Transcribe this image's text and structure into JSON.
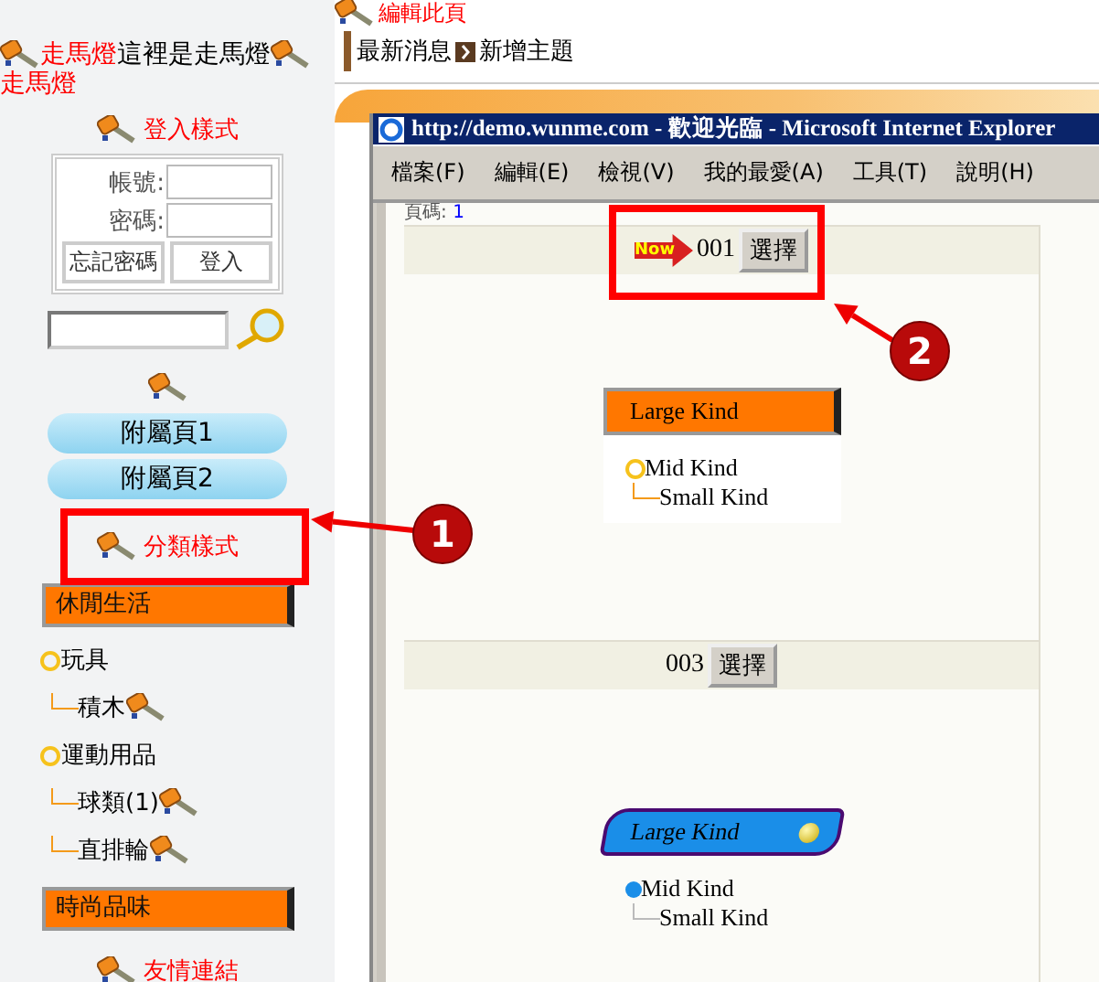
{
  "sidebar": {
    "marquee": [
      {
        "text": "走馬燈",
        "highlight": true
      },
      {
        "text": "這裡是走馬燈",
        "highlight": false
      },
      {
        "text": "走馬燈",
        "highlight": true
      }
    ],
    "login": {
      "title": "登入樣式",
      "fields": [
        {
          "label": "帳號:"
        },
        {
          "label": "密碼:"
        }
      ],
      "buttons": [
        "忘記密碼",
        "登入"
      ]
    },
    "pages": [
      "附屬頁1",
      "附屬頁2"
    ],
    "category_title": "分類樣式",
    "categories": [
      {
        "label": "休閒生活",
        "children": [
          {
            "label": "玩具",
            "children": [
              {
                "label": "積木"
              }
            ]
          },
          {
            "label": "運動用品",
            "children": [
              {
                "label": "球類(1)"
              },
              {
                "label": "直排輪"
              }
            ]
          }
        ]
      },
      {
        "label": "時尚品味"
      }
    ],
    "links_title": "友情連結"
  },
  "edit_link": "編輯此頁",
  "breadcrumb": [
    "最新消息",
    "新增主題"
  ],
  "browser": {
    "title": "http://demo.wunme.com - 歡迎光臨 - Microsoft Internet Explorer",
    "menu": [
      "檔案(F)",
      "編輯(E)",
      "檢視(V)",
      "我的最愛(A)",
      "工具(T)",
      "說明(H)"
    ],
    "page_label": "頁碼:",
    "page_link": "1",
    "styles": [
      {
        "marker": "Now",
        "number": "001",
        "button": "選擇",
        "kind": "ribbon",
        "large": "Large Kind",
        "mid": "Mid Kind",
        "small": "Small Kind"
      },
      {
        "number": "003",
        "button": "選擇",
        "kind": "capsule",
        "large": "Large Kind",
        "mid": "Mid Kind",
        "small": "Small Kind"
      }
    ]
  },
  "callouts": [
    {
      "number": "1"
    },
    {
      "number": "2"
    }
  ]
}
